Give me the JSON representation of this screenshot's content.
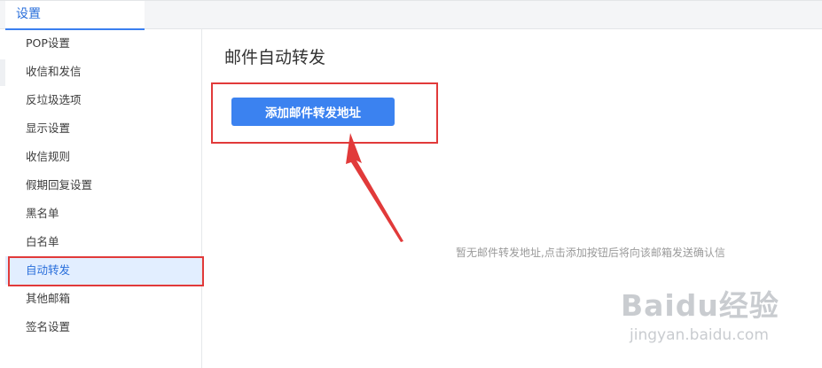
{
  "tabs": [
    {
      "label": "设置"
    }
  ],
  "sidebar": {
    "items": [
      {
        "label": "POP设置"
      },
      {
        "label": "收信和发信"
      },
      {
        "label": "反垃圾选项"
      },
      {
        "label": "显示设置"
      },
      {
        "label": "收信规则"
      },
      {
        "label": "假期回复设置"
      },
      {
        "label": "黑名单"
      },
      {
        "label": "白名单"
      },
      {
        "label": "自动转发",
        "active": true
      },
      {
        "label": "其他邮箱"
      },
      {
        "label": "签名设置"
      }
    ]
  },
  "main": {
    "title": "邮件自动转发",
    "add_button_label": "添加邮件转发地址",
    "empty_message": "暂无邮件转发地址,点击添加按钮后将向该邮箱发送确认信"
  },
  "watermark": {
    "text": "Baidu经验",
    "subtext": "jingyan.baidu.com"
  },
  "colors": {
    "accent": "#3b82f0",
    "highlight": "#e13a3a",
    "active_bg": "#e2eeff"
  }
}
